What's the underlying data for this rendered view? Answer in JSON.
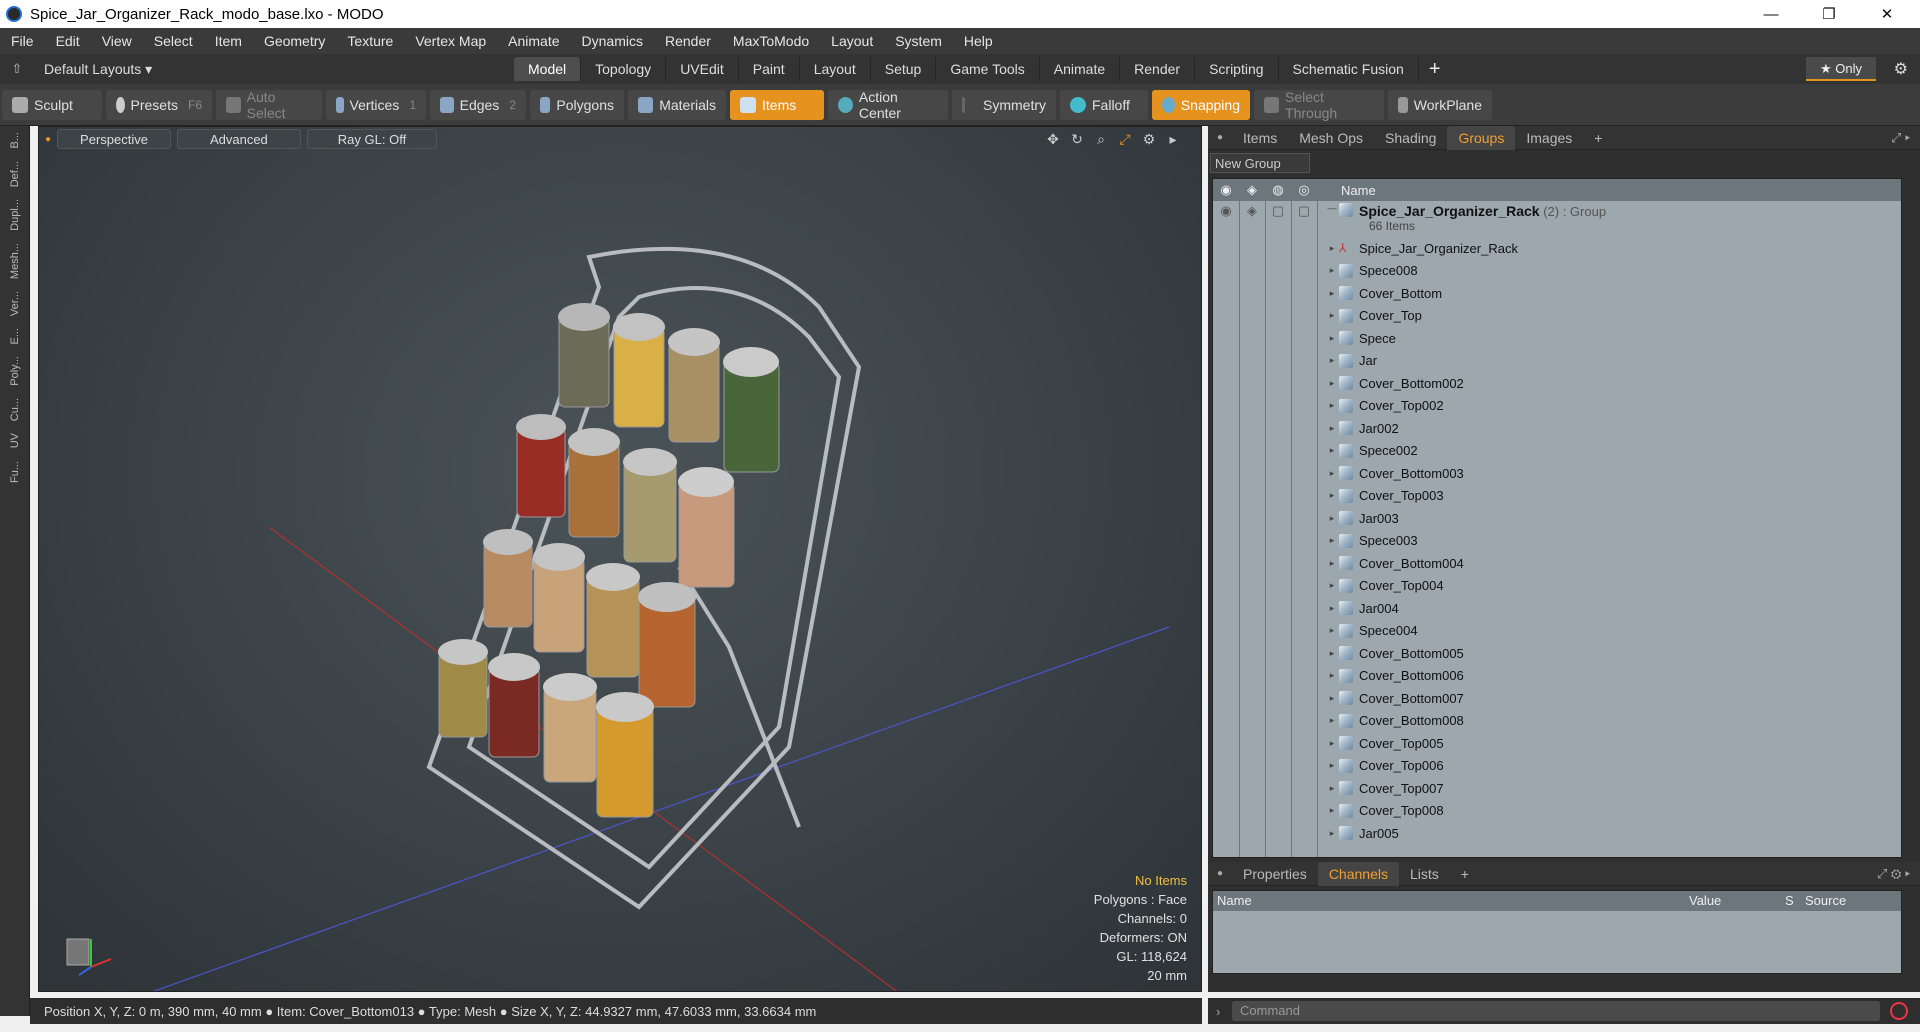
{
  "window": {
    "title": "Spice_Jar_Organizer_Rack_modo_base.lxo - MODO",
    "minimize": "—",
    "maximize": "❐",
    "close": "✕"
  },
  "menu": [
    "File",
    "Edit",
    "View",
    "Select",
    "Item",
    "Geometry",
    "Texture",
    "Vertex Map",
    "Animate",
    "Dynamics",
    "Render",
    "MaxToModo",
    "Layout",
    "System",
    "Help"
  ],
  "layoutbar": {
    "layouts_label": "Default Layouts ▾",
    "tabs": [
      "Model",
      "Topology",
      "UVEdit",
      "Paint",
      "Layout",
      "Setup",
      "Game Tools",
      "Animate",
      "Render",
      "Scripting",
      "Schematic Fusion"
    ],
    "active": "Model",
    "add": "+",
    "only": "★  Only"
  },
  "toolbar": {
    "sculpt": "Sculpt",
    "presets": "Presets",
    "presets_key": "F6",
    "auto_select": "Auto Select",
    "vertices": "Vertices",
    "vertices_count": "1",
    "edges": "Edges",
    "edges_count": "2",
    "polygons": "Polygons",
    "materials": "Materials",
    "items": "Items",
    "action_center": "Action Center",
    "symmetry": "Symmetry",
    "falloff": "Falloff",
    "snapping": "Snapping",
    "select_through": "Select Through",
    "workplane": "WorkPlane"
  },
  "left_tabs": [
    "B...",
    "Def...",
    "Dupl...",
    "Mesh...",
    "Ver...",
    "E...",
    "Poly...",
    "Cu...",
    "UV",
    "Fu..."
  ],
  "viewport": {
    "perspective": "Perspective",
    "advanced": "Advanced",
    "raygl": "Ray GL: Off",
    "stats": {
      "items": "No Items",
      "polygons": "Polygons : Face",
      "channels": "Channels: 0",
      "deformers": "Deformers: ON",
      "gl": "GL: 118,624",
      "scale": "20 mm"
    }
  },
  "panel_tabs": {
    "tabs": [
      "Items",
      "Mesh Ops",
      "Shading",
      "Groups",
      "Images"
    ],
    "active": "Groups",
    "add": "+"
  },
  "groups": {
    "new_group": "New Group",
    "header_name": "Name",
    "root": {
      "name": "Spice_Jar_Organizer_Rack",
      "count": "(2)",
      "type": ": Group",
      "items_count": "66 Items"
    },
    "items": [
      "Spice_Jar_Organizer_Rack",
      "Spece008",
      "Cover_Bottom",
      "Cover_Top",
      "Spece",
      "Jar",
      "Cover_Bottom002",
      "Cover_Top002",
      "Jar002",
      "Spece002",
      "Cover_Bottom003",
      "Cover_Top003",
      "Jar003",
      "Spece003",
      "Cover_Bottom004",
      "Cover_Top004",
      "Jar004",
      "Spece004",
      "Cover_Bottom005",
      "Cover_Bottom006",
      "Cover_Bottom007",
      "Cover_Bottom008",
      "Cover_Top005",
      "Cover_Top006",
      "Cover_Top007",
      "Cover_Top008",
      "Jar005"
    ]
  },
  "bottom_tabs": {
    "tabs": [
      "Properties",
      "Channels",
      "Lists"
    ],
    "active": "Channels",
    "add": "+"
  },
  "channels": {
    "name": "Name",
    "value": "Value",
    "s": "S",
    "source": "Source"
  },
  "status": "Position X, Y, Z:   0 m, 390 mm, 40 mm ● Item:  Cover_Bottom013 ● Type:  Mesh ● Size X, Y, Z:   44.9327 mm, 47.6033 mm, 33.6634 mm",
  "command_placeholder": "Command"
}
